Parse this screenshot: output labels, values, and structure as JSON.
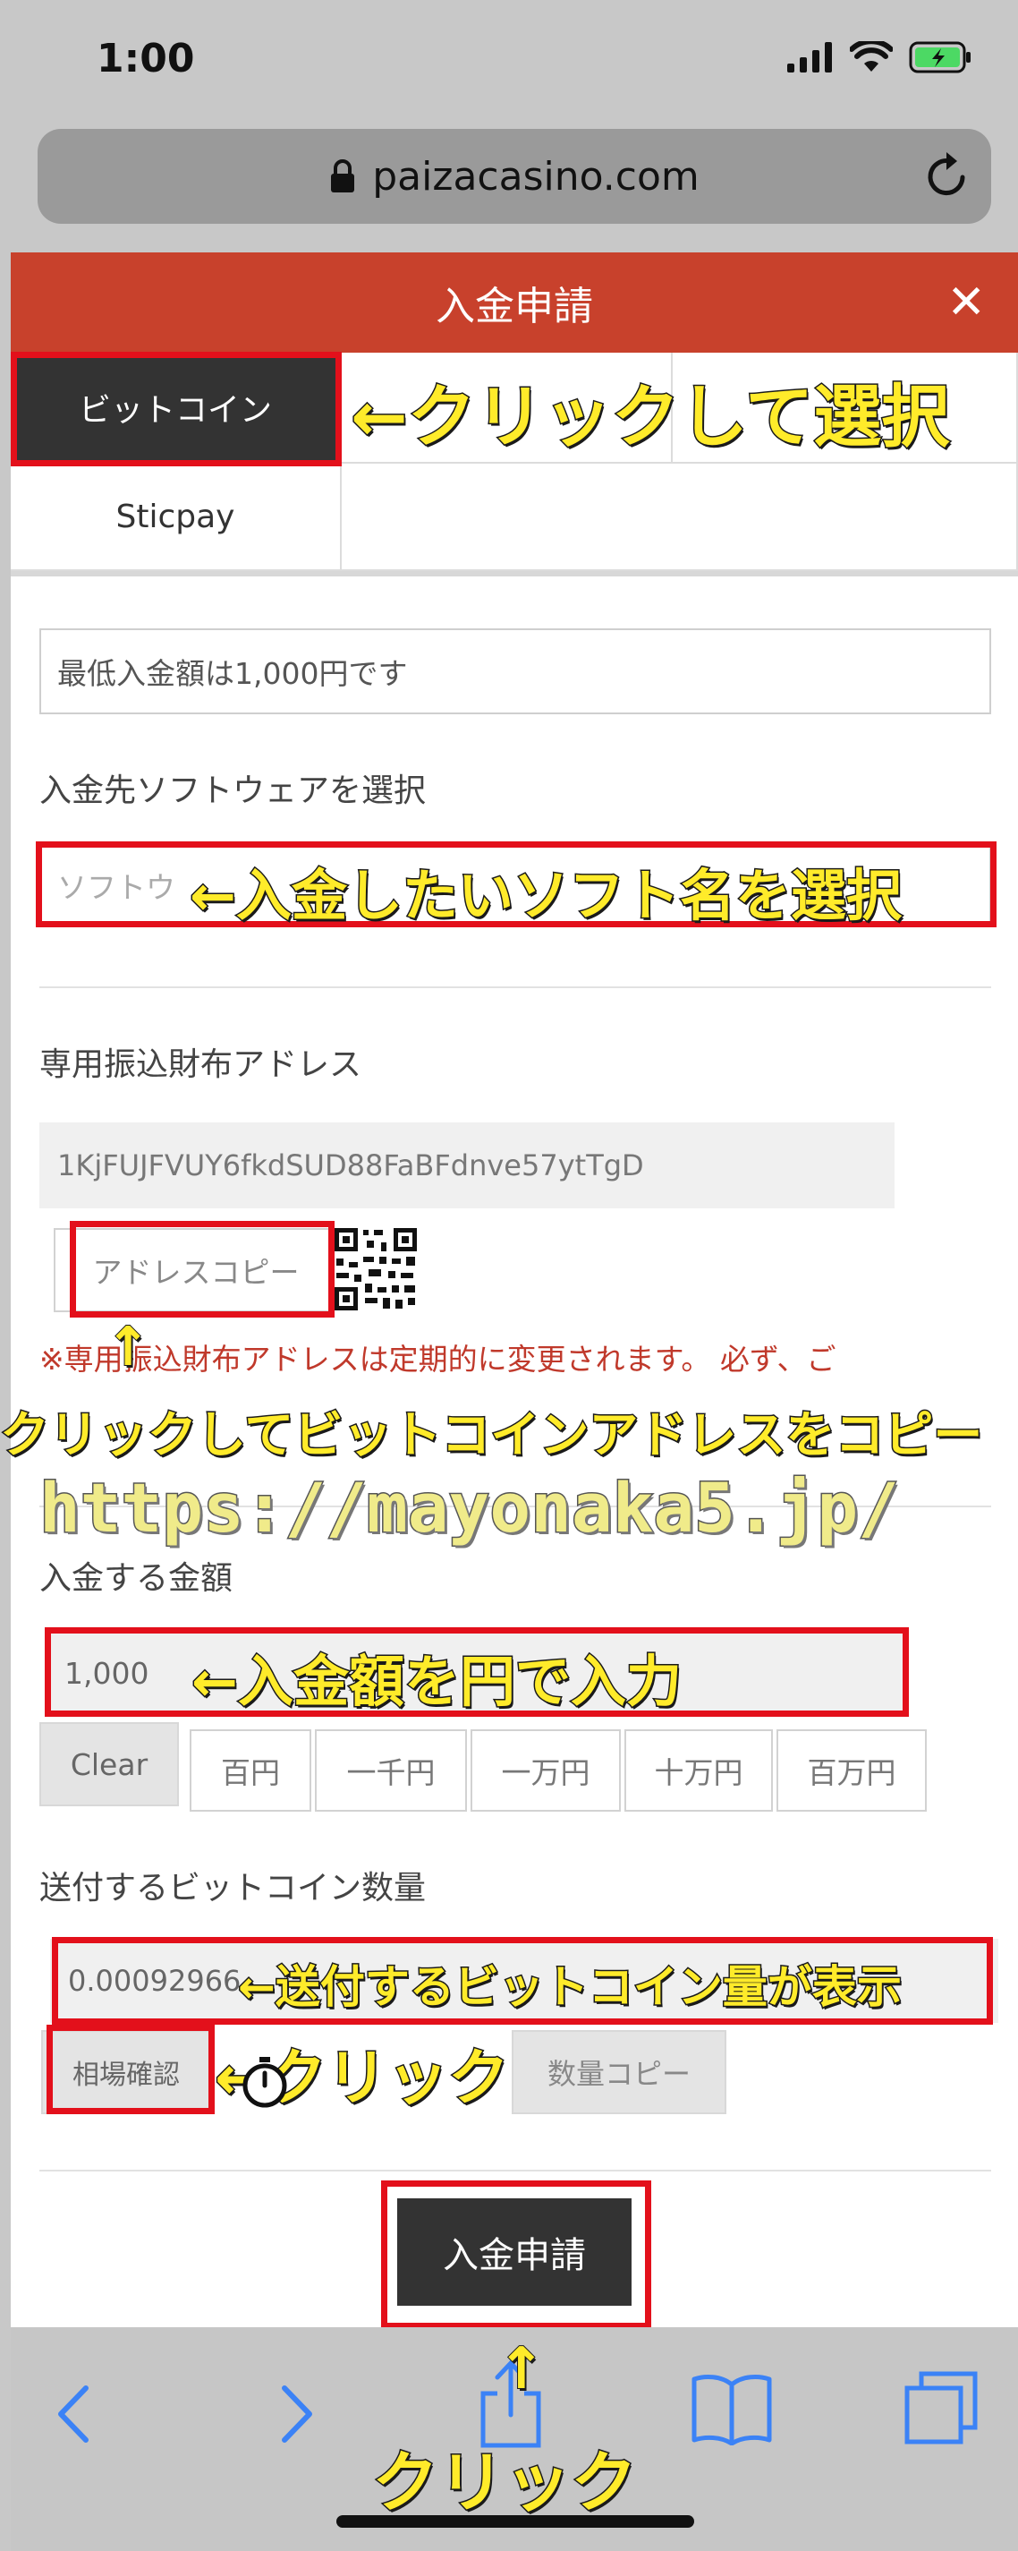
{
  "status_bar": {
    "time": "1:00"
  },
  "browser": {
    "url": "paizacasino.com"
  },
  "modal": {
    "title": "入金申請",
    "close_glyph": "✕"
  },
  "methods": [
    {
      "label": "ビットコイン",
      "selected": true
    },
    {
      "label": "",
      "selected": false
    },
    {
      "label": "",
      "selected": false
    },
    {
      "label": "Sticpay",
      "selected": false
    }
  ],
  "form": {
    "min_notice": "最低入金額は1,000円です",
    "software_label": "入金先ソフトウェアを選択",
    "software_placeholder": "ソフトウ",
    "wallet_label": "専用振込財布アドレス",
    "wallet_address": "1KjFUJFVUY6fkdSUD88FaBFdnve57ytTgD",
    "copy_address": "アドレスコピー",
    "wallet_notice_1": "※専用振込財布アドレスは定期的に変更されます。 必ず、ご",
    "amount_label": "入金する金額",
    "amount_value": "1,000",
    "clear": "Clear",
    "presets": [
      "百円",
      "一千円",
      "一万円",
      "十万円",
      "百万円"
    ],
    "btc_label": "送付するビットコイン数量",
    "btc_value": "0.00092966",
    "rate_check": "相場確認",
    "qty_copy": "数量コピー",
    "submit": "入金申請"
  },
  "annotations": {
    "select_method": "←クリックして選択",
    "select_software": "←入金したいソフト名を選択",
    "copy_address": "クリックしてビットコインアドレスをコピー",
    "watermark": "https://mayonaka5.jp/",
    "enter_amount": "←入金額を円で入力",
    "btc_shown": "←送付するビットコイン量が表示",
    "click_rate": "←クリック",
    "click_submit": "クリック",
    "arrow_up": "↑"
  },
  "colors": {
    "header_red": "#c8412c",
    "frame_red": "#e3101b",
    "caption_yellow": "#ffeb2a",
    "toolbar_blue": "#3b82f6"
  },
  "icons": [
    "signal-icon",
    "wifi-icon",
    "battery-icon",
    "lock-icon",
    "reload-icon",
    "close-icon",
    "qr-code-icon",
    "back-icon",
    "forward-icon",
    "share-icon",
    "bookmarks-icon",
    "tabs-icon"
  ]
}
